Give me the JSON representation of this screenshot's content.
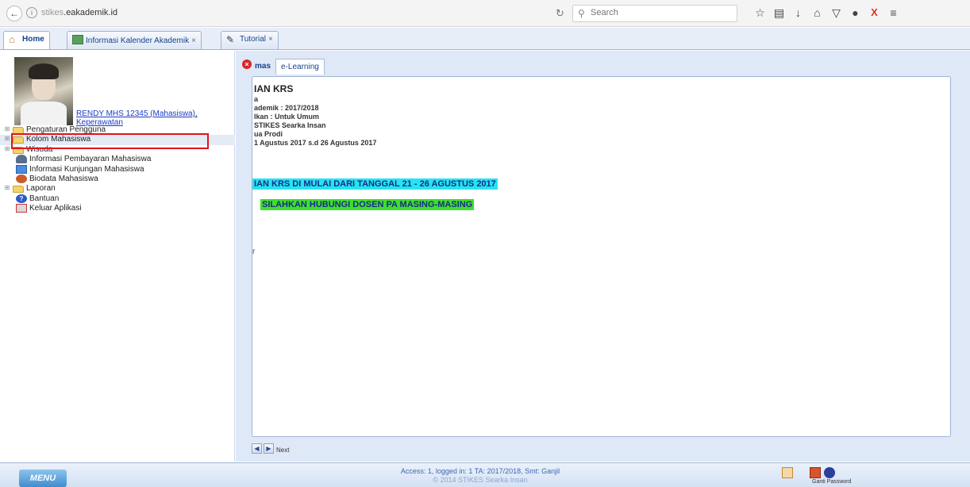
{
  "browser": {
    "url_prefix": "stikes",
    "url_main": "eakademik.id",
    "search_placeholder": "Search",
    "toolbar_icons": [
      "star-icon",
      "clipboard-icon",
      "download-icon",
      "home-icon",
      "pocket-icon",
      "circle-icon",
      "x-icon",
      "menu-icon"
    ]
  },
  "app_tabs": [
    {
      "label": "Home",
      "icon": "home-icon"
    },
    {
      "label": "Informasi Kalender Akademik",
      "icon": "calendar-icon"
    },
    {
      "label": "Tutorial",
      "icon": "pencil-icon"
    }
  ],
  "profile": {
    "link_text": "RENDY MHS 12345 (Mahasiswa), Keperawatan"
  },
  "tree": [
    {
      "label": "Pengaturan Pengguna",
      "type": "folder"
    },
    {
      "label": "Kolom Mahasiswa",
      "type": "folder"
    },
    {
      "label": "Wisuda",
      "type": "folder"
    },
    {
      "label": "Informasi Pembayaran Mahasiswa",
      "type": "leaf"
    },
    {
      "label": "Informasi Kunjungan Mahasiswa",
      "type": "leaf"
    },
    {
      "label": "Biodata Mahasiswa",
      "type": "leaf"
    },
    {
      "label": "Laporan",
      "type": "folder"
    },
    {
      "label": "Bantuan",
      "type": "leaf"
    },
    {
      "label": "Keluar Aplikasi",
      "type": "leaf"
    }
  ],
  "inner_tabs": [
    "mas",
    "e-Learning"
  ],
  "content": {
    "title": "IAN KRS",
    "lines": [
      "a",
      "ademik : 2017/2018",
      "Ikan : Untuk Umum",
      "STIKES Searka Insan",
      "ua Prodi",
      "1 Agustus 2017 s.d 26 Agustus 2017"
    ],
    "banner1": "IAN KRS DI MULAI DARI TANGGAL 21 - 26 AGUSTUS 2017",
    "banner2": "SILAHKAN HUBUNGI DOSEN PA MASING-MASING",
    "stray": "r"
  },
  "pager": {
    "text": "Next"
  },
  "footer": {
    "menu_label": "MENU",
    "line1": "Access: 1, logged in: 1 TA: 2017/2018, Smt: Ganjil",
    "line2": "© 2014 STIKES Searka Insan",
    "icon_labels": [
      "",
      "Ganti Password"
    ]
  }
}
